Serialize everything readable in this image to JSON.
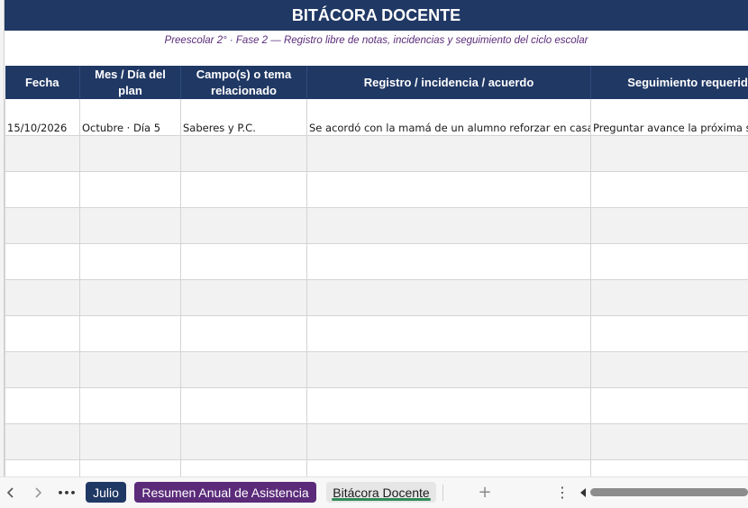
{
  "sheet": {
    "title": "BITÁCORA DOCENTE",
    "subtitle": "Preescolar 2° · Fase 2 — Registro libre de notas, incidencias y seguimiento del ciclo escolar",
    "columns": [
      "Fecha",
      "Mes / Día del plan",
      "Campo(s) o tema relacionado",
      "Registro / incidencia / acuerdo",
      "Seguimiento requerido"
    ],
    "rows": [
      [
        "15/10/2026",
        "Octubre · Día 5",
        "Saberes y P.C.",
        "Se acordó con la mamá de un alumno reforzar en casa el",
        "Preguntar avance la próxima se"
      ],
      [
        "",
        "",
        "",
        "",
        ""
      ],
      [
        "",
        "",
        "",
        "",
        ""
      ],
      [
        "",
        "",
        "",
        "",
        ""
      ],
      [
        "",
        "",
        "",
        "",
        ""
      ],
      [
        "",
        "",
        "",
        "",
        ""
      ],
      [
        "",
        "",
        "",
        "",
        ""
      ],
      [
        "",
        "",
        "",
        "",
        ""
      ],
      [
        "",
        "",
        "",
        "",
        ""
      ],
      [
        "",
        "",
        "",
        "",
        ""
      ],
      [
        "",
        "",
        "",
        "",
        ""
      ]
    ]
  },
  "tabs": {
    "more": "•••",
    "items": [
      "Julio",
      "Resumen Anual de Asistencia",
      "Bitácora Docente"
    ],
    "active": "Bitácora Docente",
    "add": "+",
    "menu": "⋮"
  },
  "colors": {
    "header_navy": "#203864",
    "subtitle_purple": "#5b2b7a",
    "tab_julio": "#203864",
    "tab_resumen": "#5b2b7a",
    "active_underline": "#2e8b57"
  }
}
